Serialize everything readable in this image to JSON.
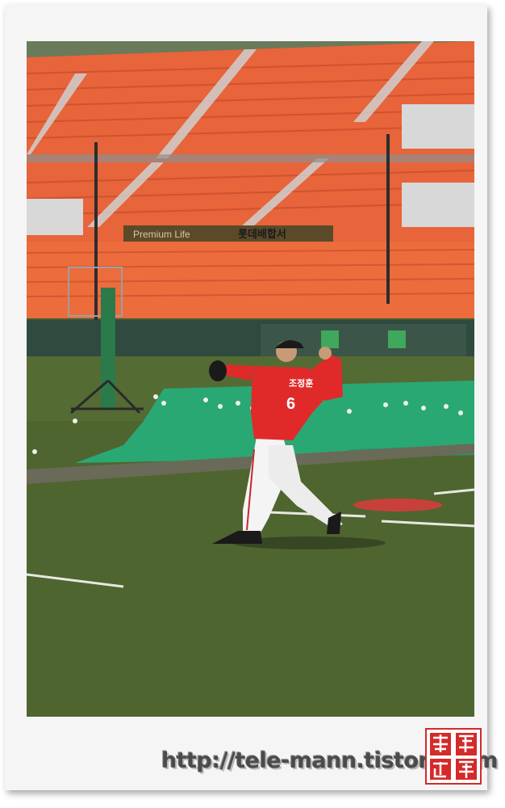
{
  "photo": {
    "banner_left": "Premium Life",
    "banner_right": "롯데배합서",
    "jersey_name": "조정훈",
    "jersey_number": "6"
  },
  "footer": {
    "url": "http://tele-mann.tistory.com"
  },
  "seal": {
    "text": "難得",
    "color": "#d42a2a"
  }
}
